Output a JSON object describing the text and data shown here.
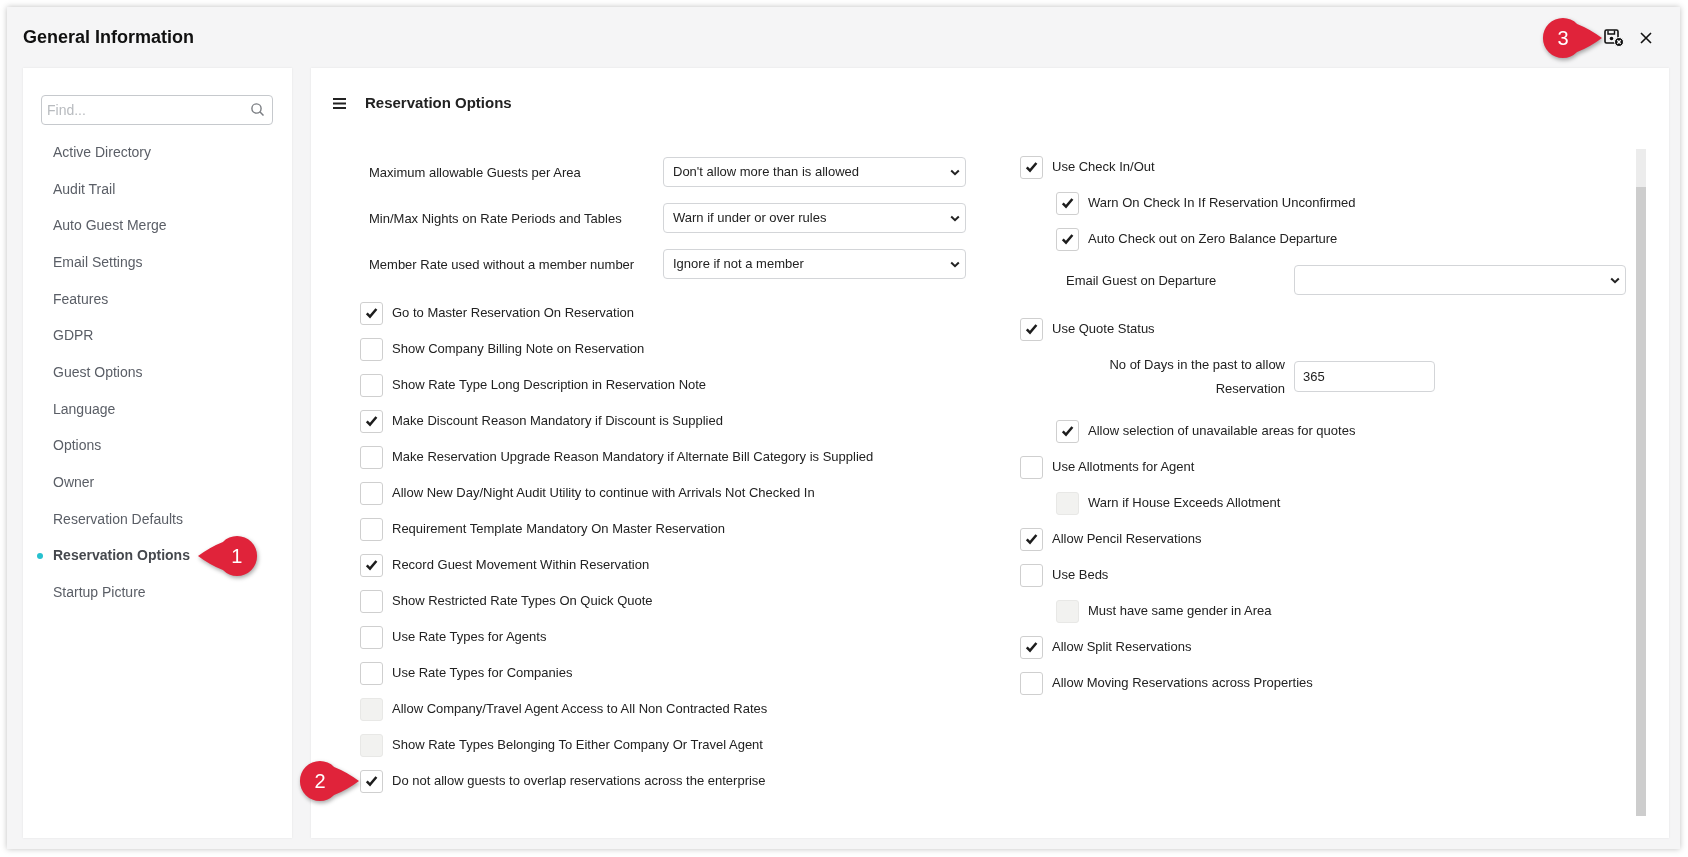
{
  "window": {
    "title": "General Information",
    "actions": [
      {
        "kind": "save",
        "callout": "3"
      },
      {
        "kind": "close"
      }
    ]
  },
  "sidebar": {
    "search": {
      "placeholder": "Find..."
    },
    "items": [
      {
        "label": "Active Directory",
        "selected": false
      },
      {
        "label": "Audit Trail",
        "selected": false
      },
      {
        "label": "Auto Guest Merge",
        "selected": false
      },
      {
        "label": "Email Settings",
        "selected": false
      },
      {
        "label": "Features",
        "selected": false
      },
      {
        "label": "GDPR",
        "selected": false
      },
      {
        "label": "Guest Options",
        "selected": false
      },
      {
        "label": "Language",
        "selected": false
      },
      {
        "label": "Options",
        "selected": false
      },
      {
        "label": "Owner",
        "selected": false
      },
      {
        "label": "Reservation Defaults",
        "selected": false
      },
      {
        "label": "Reservation Options",
        "selected": true,
        "callout": "1"
      },
      {
        "label": "Startup Picture",
        "selected": false
      }
    ]
  },
  "panel": {
    "title": "Reservation Options",
    "columns": [
      {
        "settings": [
          {
            "kind": "select",
            "label": "Maximum allowable Guests per Area",
            "value": "Don't allow more than is allowed"
          },
          {
            "kind": "select",
            "label": "Min/Max Nights on Rate Periods and Tables",
            "value": "Warn if under or over rules"
          },
          {
            "kind": "select",
            "label": "Member Rate used without a member number",
            "value": "Ignore if not a member"
          },
          {
            "kind": "checkbox",
            "label": "Go to Master Reservation On Reservation",
            "checked": true,
            "disabled": false
          },
          {
            "kind": "checkbox",
            "label": "Show Company Billing Note on Reservation",
            "checked": false,
            "disabled": false
          },
          {
            "kind": "checkbox",
            "label": "Show Rate Type Long Description in Reservation Note",
            "checked": false,
            "disabled": false
          },
          {
            "kind": "checkbox",
            "label": "Make Discount Reason Mandatory if Discount is Supplied",
            "checked": true,
            "disabled": false
          },
          {
            "kind": "checkbox",
            "label": "Make Reservation Upgrade Reason Mandatory if Alternate Bill Category is Supplied",
            "checked": false,
            "disabled": false
          },
          {
            "kind": "checkbox",
            "label": "Allow New Day/Night Audit Utility to continue with Arrivals Not Checked In",
            "checked": false,
            "disabled": false
          },
          {
            "kind": "checkbox",
            "label": "Requirement Template Mandatory On Master Reservation",
            "checked": false,
            "disabled": false
          },
          {
            "kind": "checkbox",
            "label": "Record Guest Movement Within Reservation",
            "checked": true,
            "disabled": false
          },
          {
            "kind": "checkbox",
            "label": "Show Restricted Rate Types On Quick Quote",
            "checked": false,
            "disabled": false
          },
          {
            "kind": "checkbox",
            "label": "Use Rate Types for Agents",
            "checked": false,
            "disabled": false
          },
          {
            "kind": "checkbox",
            "label": "Use Rate Types for Companies",
            "checked": false,
            "disabled": false
          },
          {
            "kind": "checkbox",
            "label": "Allow Company/Travel Agent Access to All Non Contracted Rates",
            "checked": false,
            "disabled": true
          },
          {
            "kind": "checkbox",
            "label": "Show Rate Types Belonging To Either Company Or Travel Agent",
            "checked": false,
            "disabled": true
          },
          {
            "kind": "checkbox",
            "label": "Do not allow guests to overlap reservations across the enterprise",
            "checked": true,
            "disabled": false,
            "callout": "2"
          }
        ]
      },
      {
        "settings": [
          {
            "kind": "checkbox",
            "label": "Use Check In/Out",
            "checked": true,
            "disabled": false,
            "children": [
              {
                "kind": "checkbox",
                "label": "Warn On Check In If Reservation Unconfirmed",
                "checked": true,
                "disabled": false
              },
              {
                "kind": "checkbox",
                "label": "Auto Check out on Zero Balance Departure",
                "checked": true,
                "disabled": false
              },
              {
                "kind": "select",
                "label": "Email Guest on Departure"
              }
            ]
          },
          {
            "kind": "checkbox",
            "label": "Use Quote Status",
            "checked": true,
            "disabled": false,
            "children": [
              {
                "kind": "number",
                "label": "No of Days in the past to allow Reservation",
                "value": "365"
              },
              {
                "kind": "checkbox",
                "label": "Allow selection of unavailable areas for quotes",
                "checked": true,
                "disabled": false
              }
            ]
          },
          {
            "kind": "checkbox",
            "label": "Use Allotments for Agent",
            "checked": false,
            "disabled": false,
            "children": [
              {
                "kind": "checkbox",
                "label": "Warn if House Exceeds Allotment",
                "checked": false,
                "disabled": true
              }
            ]
          },
          {
            "kind": "checkbox",
            "label": "Allow Pencil Reservations",
            "checked": true,
            "disabled": false
          },
          {
            "kind": "checkbox",
            "label": "Use Beds",
            "checked": false,
            "disabled": false,
            "children": [
              {
                "kind": "checkbox",
                "label": "Must have same gender in Area",
                "checked": false,
                "disabled": true
              }
            ]
          },
          {
            "kind": "checkbox",
            "label": "Allow Split Reservations",
            "checked": true,
            "disabled": false
          },
          {
            "kind": "checkbox",
            "label": "Allow Moving Reservations across Properties",
            "checked": false,
            "disabled": false
          }
        ]
      }
    ]
  }
}
